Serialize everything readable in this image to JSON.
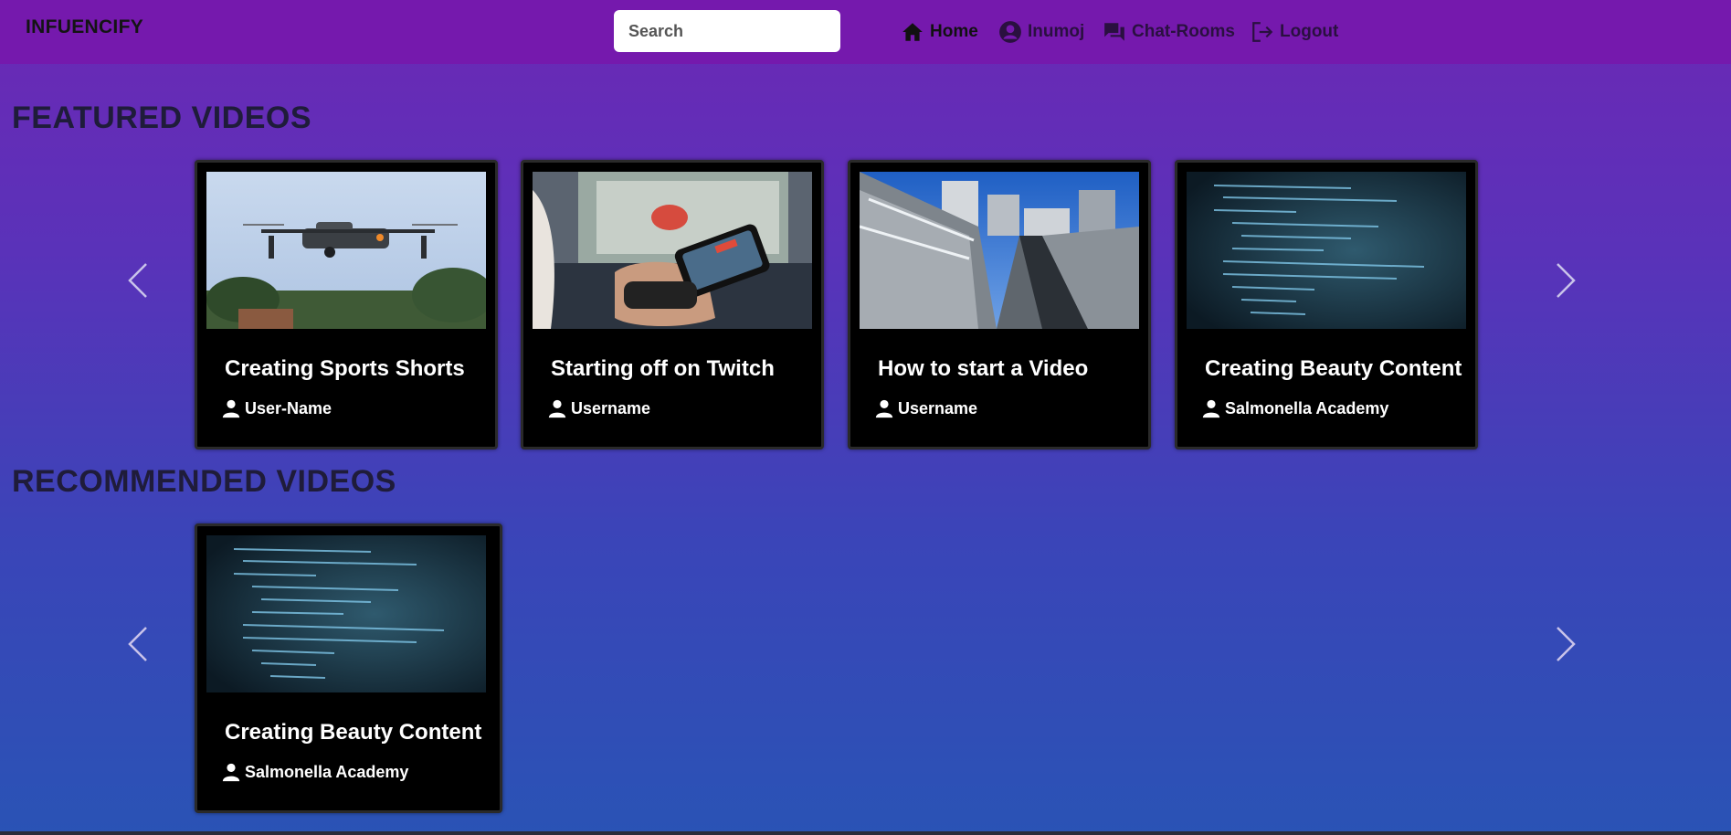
{
  "header": {
    "brand": "INFUENCIFY",
    "search_placeholder": "Search",
    "nav": {
      "home": "Home",
      "user": "Inumoj",
      "chat": "Chat-Rooms",
      "logout": "Logout"
    }
  },
  "featured": {
    "title": "FEATURED VIDEOS",
    "videos": [
      {
        "title": "Creating Sports Shorts",
        "user": "User-Name",
        "thumbnail": "drone"
      },
      {
        "title": "Starting off on Twitch",
        "user": "Username",
        "thumbnail": "phone-gaming"
      },
      {
        "title": "How to start a Video",
        "user": "Username",
        "thumbnail": "railway-city"
      },
      {
        "title": "Creating Beauty Content",
        "user": "Salmonella Academy",
        "thumbnail": "code-screen"
      }
    ]
  },
  "recommended": {
    "title": "RECOMMENDED VIDEOS",
    "videos": [
      {
        "title": "Creating Beauty Content",
        "user": "Salmonella Academy",
        "thumbnail": "code-screen"
      }
    ]
  },
  "colors": {
    "topbar": "#7519ad",
    "card": "#000000",
    "heading": "#1f1c3a"
  }
}
